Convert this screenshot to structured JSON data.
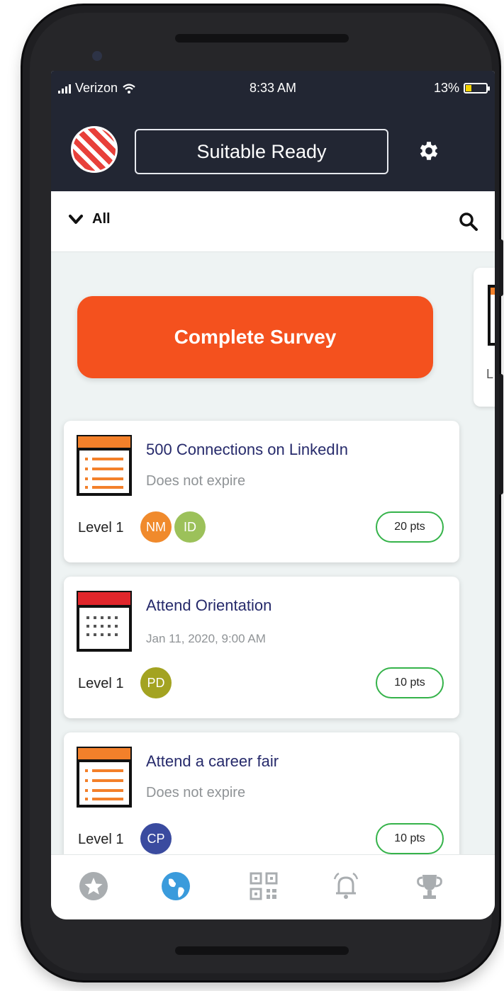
{
  "status_bar": {
    "carrier": "Verizon",
    "time": "8:33 AM",
    "battery_percent": "13%",
    "battery_level": 0.13
  },
  "header": {
    "title": "Suitable Ready",
    "settings_icon": "gear-icon"
  },
  "filter": {
    "selected": "All",
    "dropdown_icon": "chevron-down-icon",
    "search_icon": "search-icon"
  },
  "survey_button": {
    "label": "Complete Survey",
    "color": "#f4511e"
  },
  "peek_card": {
    "letter": "L"
  },
  "cards": [
    {
      "title": "500 Connections on LinkedIn",
      "subtitle": "Does not expire",
      "level": "Level 1",
      "icon": "list-document-icon",
      "avatars": [
        {
          "initials": "NM",
          "color": "#f08a2c"
        },
        {
          "initials": "ID",
          "color": "#9cc15a"
        }
      ],
      "points": "20 pts"
    },
    {
      "title": "Attend Orientation",
      "subtitle": "Jan 11, 2020, 9:00 AM",
      "level": "Level 1",
      "icon": "calendar-icon",
      "avatars": [
        {
          "initials": "PD",
          "color": "#a3a321"
        }
      ],
      "points": "10 pts"
    },
    {
      "title": "Attend a career fair",
      "subtitle": "Does not expire",
      "level": "Level 1",
      "icon": "list-document-icon",
      "avatars": [
        {
          "initials": "CP",
          "color": "#3a4b9f"
        }
      ],
      "points": "10 pts"
    }
  ],
  "bottom_nav": [
    {
      "name": "star-icon",
      "active": false
    },
    {
      "name": "globe-icon",
      "active": true
    },
    {
      "name": "qr-code-icon",
      "active": false
    },
    {
      "name": "bell-icon",
      "active": false
    },
    {
      "name": "trophy-icon",
      "active": false
    }
  ],
  "colors": {
    "header_bg": "#222633",
    "accent_orange": "#f4511e",
    "points_border": "#35b34a",
    "title_text": "#262a6b",
    "nav_active": "#3a9bdc",
    "nav_inactive": "#a9adb0"
  }
}
